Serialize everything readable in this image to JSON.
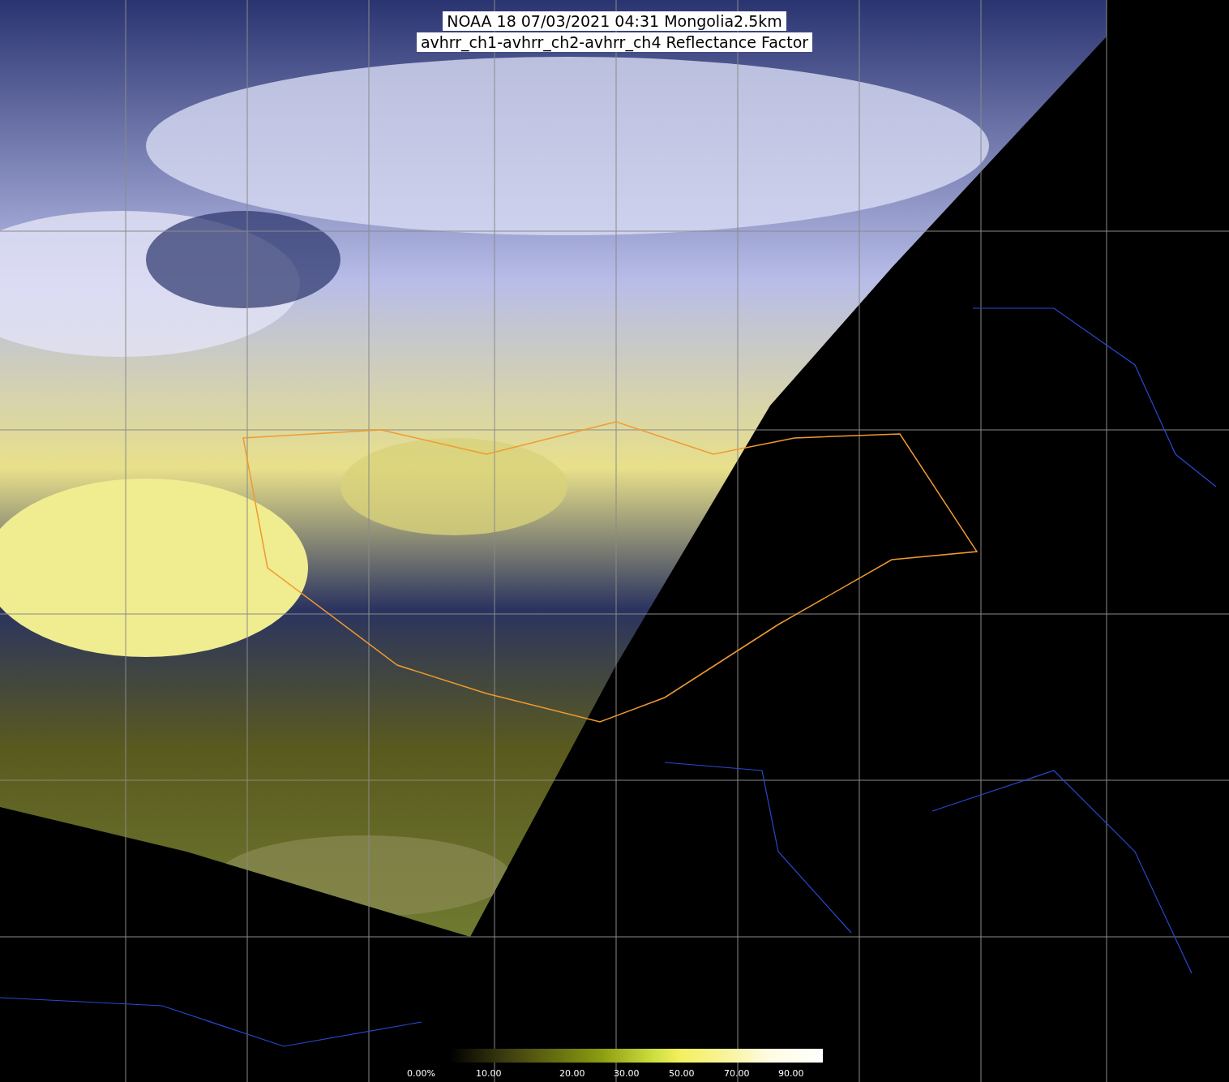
{
  "title": {
    "lines": [
      "NOAA 18 07/03/2021 04:31 Mongolia2.5km",
      "avhrr_ch1-avhrr_ch2-avhrr_ch4 Reflectance Factor"
    ]
  },
  "colorbar": {
    "labels": [
      "0.00%",
      "10.00",
      "20.00",
      "30.00",
      "50.00",
      "70.00",
      "90.00"
    ]
  }
}
